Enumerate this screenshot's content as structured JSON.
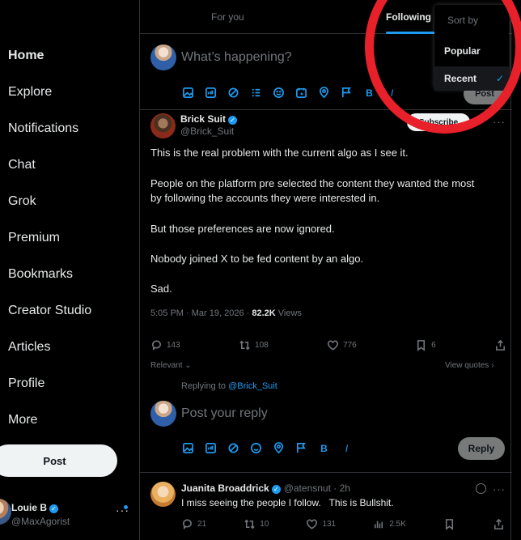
{
  "sidebar": {
    "items": [
      {
        "label": "Home",
        "icon": "home-icon"
      },
      {
        "label": "Explore",
        "icon": "search-icon"
      },
      {
        "label": "Notifications",
        "icon": "bell-icon"
      },
      {
        "label": "Chat",
        "icon": "chat-icon"
      },
      {
        "label": "Grok",
        "icon": "grok-icon"
      },
      {
        "label": "Premium",
        "icon": "x-icon"
      },
      {
        "label": "Bookmarks",
        "icon": "bookmark-icon"
      },
      {
        "label": "Creator Studio",
        "icon": "studio-icon"
      },
      {
        "label": "Articles",
        "icon": "article-icon"
      },
      {
        "label": "Profile",
        "icon": "user-icon"
      },
      {
        "label": "More",
        "icon": "more-icon"
      }
    ],
    "post_label": "Post",
    "account": {
      "name": "Louie B",
      "handle": "@MaxAgorist",
      "more": "···"
    }
  },
  "tabs": {
    "for_you": "For you",
    "following": "Following"
  },
  "compose": {
    "placeholder": "What’s happening?",
    "post_label": "Post"
  },
  "dropdown": {
    "title": "Sort by",
    "options": [
      "Popular",
      "Recent"
    ],
    "selected": "Recent",
    "check": "✓"
  },
  "tweet": {
    "name": "Brick Suit",
    "handle": "@Brick_Suit",
    "subscribe": "Subscribe",
    "more": "···",
    "lines": [
      "This is the real problem with the current algo as I see it.",
      "People on the platform pre selected the content they wanted the most",
      "by following the accounts they were interested in.",
      "But those preferences are now ignored.",
      "Nobody joined X to be fed content by an algo.",
      "Sad."
    ],
    "timestamp": "5:05 PM · Mar 19, 2026 · ",
    "views_count": "82.2K",
    "views_label": " Views",
    "replies": "143",
    "reposts": "108",
    "likes": "776",
    "bookmarks": "6",
    "relevant": "Relevant",
    "view_quotes": "View quotes"
  },
  "reply_box": {
    "replying_to": "Replying to ",
    "replying_handle": "@Brick_Suit",
    "placeholder": "Post your reply",
    "reply_label": "Reply"
  },
  "reply_tweet": {
    "name": "Juanita Broaddrick",
    "handle": "@atensnut · 2h",
    "text": "I miss seeing the people I follow.   This is Bullshit.",
    "more": "···",
    "replies": "21",
    "reposts": "10",
    "likes": "131",
    "views": "2.5K"
  },
  "colors": {
    "accent": "#1d9bf0",
    "annotation": "#e8202a",
    "background": "#000000"
  }
}
